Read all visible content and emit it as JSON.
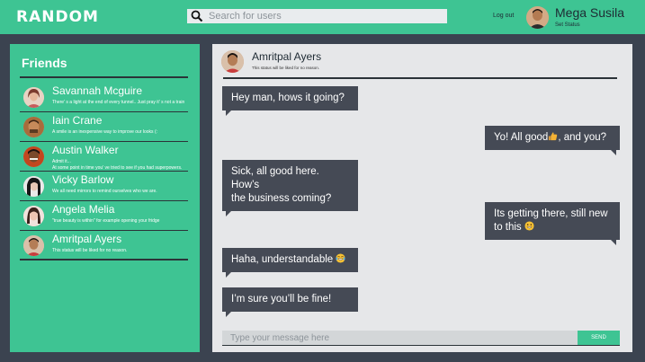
{
  "app": {
    "logo": "RANDOM"
  },
  "header": {
    "search_placeholder": "Search for users",
    "logout_label": "Log out",
    "user_name": "Mega Susila",
    "set_status_label": "Set Status"
  },
  "friends": {
    "title": "Friends",
    "items": [
      {
        "name": "Savannah Mcguire",
        "status": "There' s a light at the end of every tunnel.. Just pray  it' s not a train"
      },
      {
        "name": "Iain Crane",
        "status": "A smile is an inexpensive way to improve our looks (:"
      },
      {
        "name": "Austin Walker",
        "status": "Admit it...",
        "status2": "At some point in time you' ve tried to see if you had superpowers."
      },
      {
        "name": "Vicky Barlow",
        "status": "We all need mirrors to remind ourselves who we are."
      },
      {
        "name": "Angela Melia",
        "status": "\"true beauty is within\" for example opening your fridge"
      },
      {
        "name": "Amritpal Ayers",
        "status": "This status will be liked for no reason."
      }
    ]
  },
  "chat": {
    "contact_name": "Amritpal Ayers",
    "contact_status": "This status will be liked for no reason.",
    "messages": [
      {
        "side": "left",
        "line1": "Hey man, hows it going?"
      },
      {
        "side": "right",
        "pre": "Yo! All good",
        "emoji": "thumbs-up-emoji",
        "post": ", and you?"
      },
      {
        "side": "left",
        "line1": "Sick, all good here. How’s",
        "line2": "the business coming?"
      },
      {
        "side": "right",
        "line1": "Its getting there, still new",
        "line2": "to this",
        "emoji": "grinning-emoji"
      },
      {
        "side": "left",
        "line1": "Haha, understandable",
        "emoji": "laughing-tears-emoji"
      },
      {
        "side": "left",
        "line1": "I’m sure you’ll be fine!"
      }
    ],
    "message_placeholder": "Type your message here",
    "send_label": "SEND"
  },
  "colors": {
    "accent": "#3ec493",
    "background": "#3b4350",
    "bubble": "#454a55",
    "chat_panel": "#e6e7e9"
  }
}
